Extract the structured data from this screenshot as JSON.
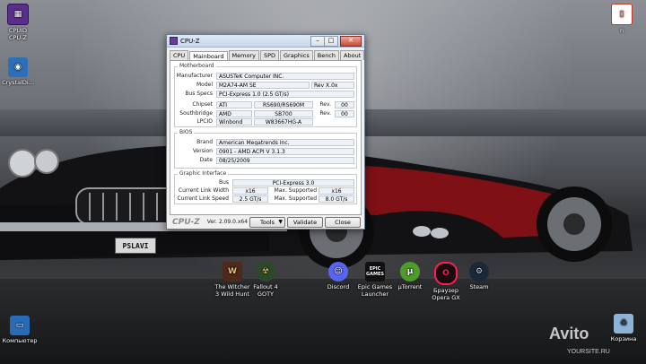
{
  "desktop": {
    "icons": [
      {
        "label": "CPUID\nCPU-Z"
      },
      {
        "label": "CrystalDi..."
      },
      {
        "label": "The Witcher\n3 Wild Hunt"
      },
      {
        "label": "Fallout 4\nGOTY"
      },
      {
        "label": "Discord"
      },
      {
        "label": "Epic Games\nLauncher"
      },
      {
        "label": "µTorrent"
      },
      {
        "label": "Браузер\nOpera GX"
      },
      {
        "label": "Steam"
      },
      {
        "label": "Компьютер"
      },
      {
        "label": "Корзина"
      },
      {
        "label": "n"
      }
    ],
    "icon_glyphs": {
      "epic": "EPIC\nGAMES"
    },
    "plate_text": "PSLAVI",
    "watermark": "Avito",
    "watermark_url": "YOURSITE.RU"
  },
  "window": {
    "title": "CPU-Z",
    "tabs": [
      "CPU",
      "Mainboard",
      "Memory",
      "SPD",
      "Graphics",
      "Bench",
      "About"
    ],
    "active_tab": "Mainboard",
    "motherboard": {
      "group_title": "Motherboard",
      "manufacturer_label": "Manufacturer",
      "manufacturer": "ASUSTeK Computer INC.",
      "model_label": "Model",
      "model": "M2A74-AM SE",
      "model_rev": "Rev X.0x",
      "bus_specs_label": "Bus Specs",
      "bus_specs": "PCI-Express 1.0 (2.5 GT/s)",
      "chipset_label": "Chipset",
      "chipset_vendor": "ATI",
      "chipset_model": "RS690/RS690M",
      "chipset_rev_label": "Rev.",
      "chipset_rev": "00",
      "southbridge_label": "Southbridge",
      "southbridge_vendor": "AMD",
      "southbridge_model": "SB700",
      "southbridge_rev_label": "Rev.",
      "southbridge_rev": "00",
      "lpcio_label": "LPCIO",
      "lpcio_vendor": "Winbond",
      "lpcio_model": "W83667HG-A"
    },
    "bios": {
      "group_title": "BIOS",
      "brand_label": "Brand",
      "brand": "American Megatrends Inc.",
      "version_label": "Version",
      "version": "0901 - AMD ACPI V 3.1.3",
      "date_label": "Date",
      "date": "08/25/2009"
    },
    "graphic": {
      "group_title": "Graphic Interface",
      "bus_label": "Bus",
      "bus": "PCI-Express 3.0",
      "link_width_label": "Current Link Width",
      "link_width": "x16",
      "max_width_label": "Max. Supported",
      "max_width": "x16",
      "link_speed_label": "Current Link Speed",
      "link_speed": "2.5 GT/s",
      "max_speed_label": "Max. Supported",
      "max_speed": "8.0 GT/s"
    },
    "footer": {
      "brand": "CPU-Z",
      "version": "Ver. 2.09.0.x64",
      "tools": "Tools",
      "validate": "Validate",
      "close": "Close"
    }
  }
}
